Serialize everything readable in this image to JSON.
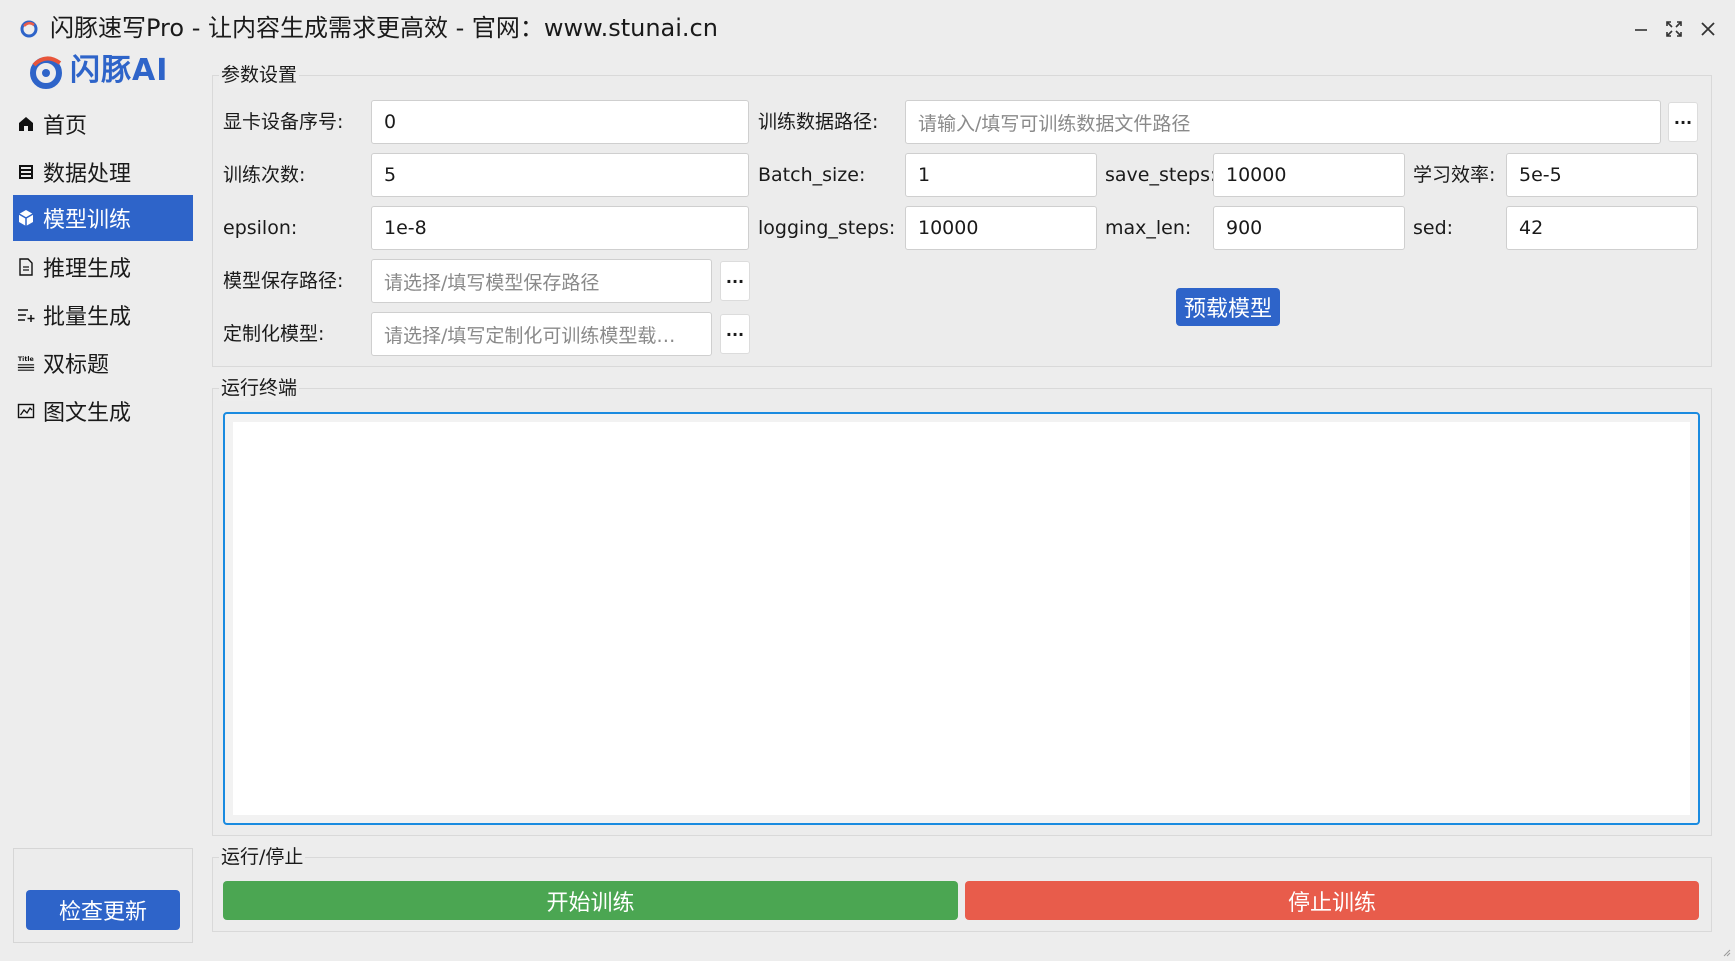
{
  "window": {
    "title": "闪豚速写Pro - 让内容生成需求更高效  -  官网：www.stunai.cn"
  },
  "logo": {
    "text": "闪豚AI"
  },
  "sidebar": {
    "items": [
      {
        "label": "首页",
        "icon": "home-icon"
      },
      {
        "label": "数据处理",
        "icon": "list-icon"
      },
      {
        "label": "模型训练",
        "icon": "cube-icon",
        "active": true
      },
      {
        "label": "推理生成",
        "icon": "document-icon"
      },
      {
        "label": "批量生成",
        "icon": "list-add-icon"
      },
      {
        "label": "双标题",
        "icon": "title-icon"
      },
      {
        "label": "图文生成",
        "icon": "image-chart-icon"
      }
    ],
    "update_label": "检查更新"
  },
  "params": {
    "group_title": "参数设置",
    "gpu_label": "显卡设备序号:",
    "gpu_value": "0",
    "train_path_label": "训练数据路径:",
    "train_path_placeholder": "请输入/填写可训练数据文件路径",
    "epochs_label": "训练次数:",
    "epochs_value": "5",
    "batch_label": "Batch_size:",
    "batch_value": "1",
    "save_steps_label": "save_steps:",
    "save_steps_value": "10000",
    "lr_label": "学习效率:",
    "lr_value": "5e-5",
    "epsilon_label": "epsilon:",
    "epsilon_value": "1e-8",
    "logging_label": "logging_steps:",
    "logging_value": "10000",
    "maxlen_label": "max_len:",
    "maxlen_value": "900",
    "sed_label": "sed:",
    "sed_value": "42",
    "save_path_label": "模型保存路径:",
    "save_path_placeholder": "请选择/填写模型保存路径",
    "custom_label": "定制化模型:",
    "custom_placeholder": "请选择/填写定制化可训练模型载…",
    "browse": "···",
    "preload_label": "预载模型"
  },
  "terminal": {
    "group_title": "运行终端"
  },
  "run": {
    "group_title": "运行/停止",
    "start_label": "开始训练",
    "stop_label": "停止训练"
  },
  "colors": {
    "accent": "#2e64c9",
    "start": "#4ba652",
    "stop": "#e85c4b",
    "terminal_border": "#1a8be0"
  }
}
